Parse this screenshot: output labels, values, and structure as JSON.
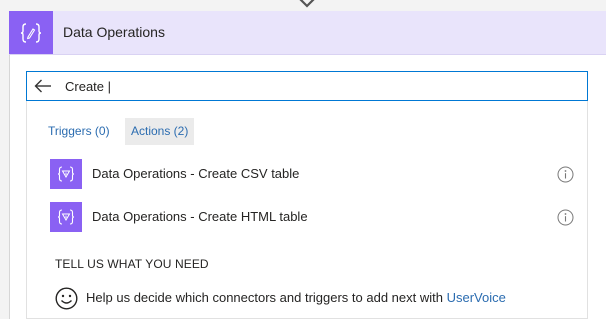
{
  "header": {
    "title": "Data Operations",
    "icon": "curly-braces-edit-icon"
  },
  "search": {
    "value": "Create |",
    "back_icon": "back-arrow-icon"
  },
  "tabs": [
    {
      "label": "Triggers (0)",
      "selected": false
    },
    {
      "label": "Actions (2)",
      "selected": true
    }
  ],
  "actions": [
    {
      "label": "Data Operations - Create CSV table",
      "icon": "data-operations-icon"
    },
    {
      "label": "Data Operations - Create HTML table",
      "icon": "data-operations-icon"
    }
  ],
  "feedback": {
    "heading": "TELL US WHAT YOU NEED",
    "text": "Help us decide which connectors and triggers to add next with",
    "link_label": "UserVoice",
    "icon": "smiley-icon"
  },
  "colors": {
    "accent": "#8a61f3",
    "header_bg": "#e9e4fb",
    "link": "#2b6cb0",
    "focus_border": "#0078d4"
  }
}
